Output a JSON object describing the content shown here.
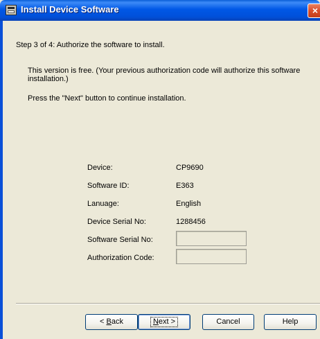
{
  "window": {
    "title": "Install Device Software",
    "close_symbol": "×"
  },
  "step_text": "Step 3 of 4:  Authorize the software to install.",
  "info_text": "This version is free. (Your previous authorization code will authorize this software installation.)",
  "press_text": "Press the \"Next\" button to continue installation.",
  "fields": [
    {
      "label": "Device:",
      "value": "CP9690"
    },
    {
      "label": "Software ID:",
      "value": "E363"
    },
    {
      "label": "Lanuage:",
      "value": "English"
    },
    {
      "label": "Device Serial No:",
      "value": "1288456"
    },
    {
      "label": "Software Serial No:",
      "value": ""
    },
    {
      "label": "Authorization Code:",
      "value": ""
    }
  ],
  "buttons": {
    "back": {
      "prefix": "< ",
      "mnemonic": "B",
      "rest": "ack"
    },
    "next": {
      "mnemonic": "N",
      "rest": "ext >"
    },
    "cancel": {
      "label": "Cancel"
    },
    "help": {
      "label": "Help"
    }
  }
}
